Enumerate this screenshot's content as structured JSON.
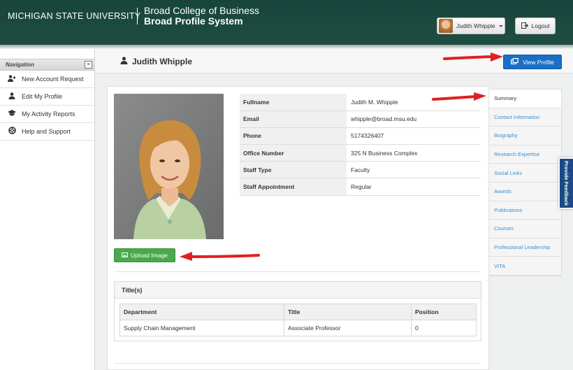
{
  "header": {
    "university": "MICHIGAN STATE UNIVERSITY",
    "college_line1": "Broad College of Business",
    "college_line2": "Broad Profile System",
    "user_menu_label": "Judith Whipple",
    "logout_label": "Logout",
    "background_color": "#18453b"
  },
  "sidebar": {
    "heading": "Navigation",
    "items": [
      {
        "label": "New Account Request",
        "icon": "user-plus-icon"
      },
      {
        "label": "Edit My Profile",
        "icon": "user-icon"
      },
      {
        "label": "My Activity Reports",
        "icon": "graduation-cap-icon"
      },
      {
        "label": "Help and Support",
        "icon": "life-ring-icon"
      }
    ]
  },
  "page": {
    "title": "Judith Whipple",
    "view_profile_label": "View Profile"
  },
  "profile": {
    "fields": [
      {
        "label": "Fullname",
        "value": "Judith M. Whipple"
      },
      {
        "label": "Email",
        "value": "whipple@broad.msu.edu"
      },
      {
        "label": "Phone",
        "value": "5174326407"
      },
      {
        "label": "Office Number",
        "value": "325 N Business Complex"
      },
      {
        "label": "Staff Type",
        "value": "Faculty"
      },
      {
        "label": "Staff Appointment",
        "value": "Regular"
      }
    ],
    "upload_label": "Upload Image"
  },
  "titles": {
    "heading": "Title(s)",
    "columns": [
      "Department",
      "Title",
      "Position"
    ],
    "rows": [
      [
        "Supply Chain Management",
        "Associate Professor",
        "0"
      ]
    ]
  },
  "tabs": [
    "Summary",
    "Contact Information",
    "Biography",
    "Research Expertise",
    "Social Links",
    "Awards",
    "Publications",
    "Courses",
    "Professional Leadership",
    "VITA"
  ],
  "feedback_label": "Provide Feedback",
  "colors": {
    "primary_button": "#1a6fc6",
    "success_button": "#4aa84d",
    "link": "#3a8fd0",
    "arrow": "#e02020"
  }
}
